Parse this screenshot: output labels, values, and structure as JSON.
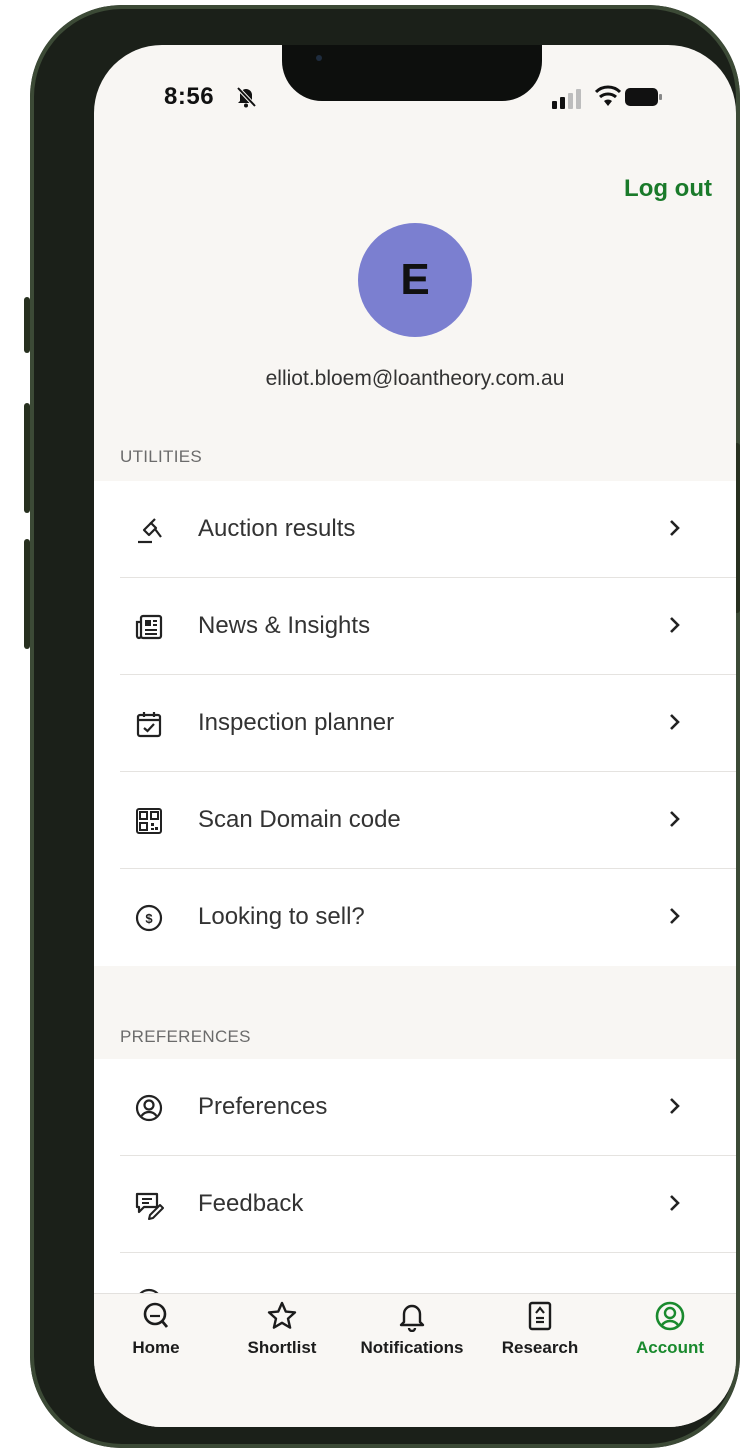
{
  "status_bar": {
    "time": "8:56"
  },
  "header": {
    "logout_label": "Log out",
    "avatar_initial": "E",
    "email": "elliot.bloem@loantheory.com.au"
  },
  "utilities": {
    "title": "UTILITIES",
    "items": [
      {
        "label": "Auction results",
        "icon": "gavel-icon"
      },
      {
        "label": "News & Insights",
        "icon": "newspaper-icon"
      },
      {
        "label": "Inspection planner",
        "icon": "calendar-check-icon"
      },
      {
        "label": "Scan Domain code",
        "icon": "qr-code-icon"
      },
      {
        "label": "Looking to sell?",
        "icon": "dollar-circle-icon"
      }
    ]
  },
  "preferences": {
    "title": "PREFERENCES",
    "items": [
      {
        "label": "Preferences",
        "icon": "user-circle-icon"
      },
      {
        "label": "Feedback",
        "icon": "feedback-icon"
      }
    ]
  },
  "tabbar": {
    "items": [
      {
        "label": "Home",
        "icon": "search-icon",
        "active": false
      },
      {
        "label": "Shortlist",
        "icon": "star-icon",
        "active": false
      },
      {
        "label": "Notifications",
        "icon": "bell-icon",
        "active": false
      },
      {
        "label": "Research",
        "icon": "research-icon",
        "active": false
      },
      {
        "label": "Account",
        "icon": "account-icon",
        "active": true
      }
    ]
  },
  "colors": {
    "accent_green": "#1a7a2a",
    "avatar_bg": "#7b7fd0",
    "screen_bg": "#f8f6f3",
    "frame": "#1b2019"
  }
}
